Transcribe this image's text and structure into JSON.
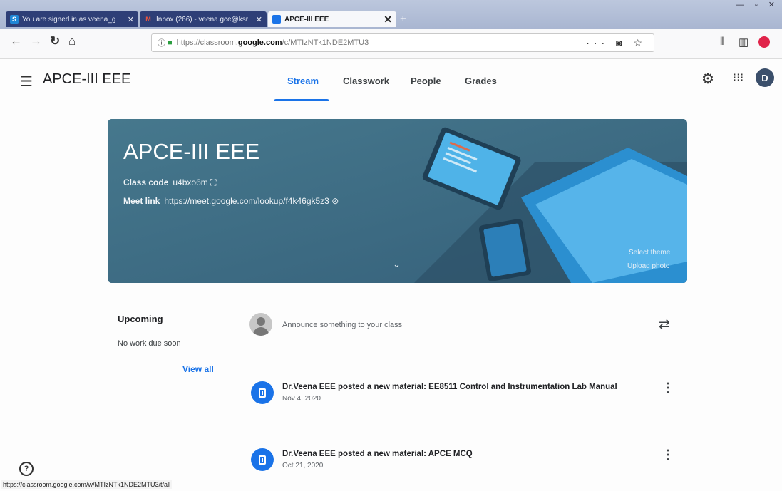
{
  "browser": {
    "tabs": [
      {
        "title": "You are signed in as veena_g",
        "favicon": "S",
        "active": false
      },
      {
        "title": "Inbox (266) - veena.gce@ksr",
        "favicon": "M",
        "active": false
      },
      {
        "title": "APCE-III EEE",
        "favicon": "",
        "active": true
      }
    ],
    "url_prefix": "https://classroom.",
    "url_domain": "google.com",
    "url_path": "/c/MTIzNTk1NDE2MTU3",
    "status_url": "https://classroom.google.com/w/MTIzNTk1NDE2MTU3/t/all"
  },
  "header": {
    "app_title": "APCE-III EEE",
    "tabs": [
      "Stream",
      "Classwork",
      "People",
      "Grades"
    ],
    "active_tab": "Stream",
    "avatar_initial": "D"
  },
  "banner": {
    "title": "APCE-III EEE",
    "class_code_label": "Class code",
    "class_code": "u4bxo6m",
    "meet_label": "Meet link",
    "meet_url": "https://meet.google.com/lookup/f4k46gk5z3",
    "select_theme": "Select theme",
    "upload_photo": "Upload photo"
  },
  "upcoming": {
    "title": "Upcoming",
    "empty": "No work due soon",
    "view_all": "View all"
  },
  "announce": {
    "placeholder": "Announce something to your class"
  },
  "posts": [
    {
      "title": "Dr.Veena EEE posted a new material: EE8511 Control and Instrumentation Lab Manual",
      "date": "Nov 4, 2020"
    },
    {
      "title": "Dr.Veena EEE posted a new material: APCE MCQ",
      "date": "Oct 21, 2020"
    }
  ],
  "colors": {
    "accent": "#1a73e8",
    "banner": "#3f6f84"
  }
}
